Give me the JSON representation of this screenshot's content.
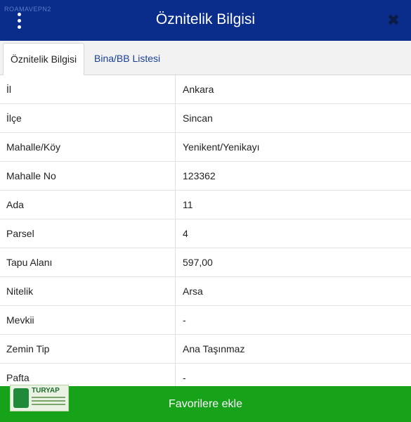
{
  "header": {
    "title": "Öznitelik Bilgisi",
    "corner_text": "ROAMAVEPN2",
    "menu_icon": "vertical-dots-icon",
    "close_icon": "close-icon",
    "close_glyph": "✖"
  },
  "tabs": [
    {
      "label": "Öznitelik Bilgisi",
      "active": true
    },
    {
      "label": "Bina/BB Listesi",
      "active": false
    }
  ],
  "rows": [
    {
      "label": "İl",
      "value": "Ankara"
    },
    {
      "label": "İlçe",
      "value": "Sincan"
    },
    {
      "label": "Mahalle/Köy",
      "value": "Yenikent/Yenikayı"
    },
    {
      "label": "Mahalle No",
      "value": "123362"
    },
    {
      "label": "Ada",
      "value": "11"
    },
    {
      "label": "Parsel",
      "value": "4"
    },
    {
      "label": "Tapu Alanı",
      "value": "597,00"
    },
    {
      "label": "Nitelik",
      "value": "Arsa"
    },
    {
      "label": "Mevkii",
      "value": "-"
    },
    {
      "label": "Zemin Tip",
      "value": "Ana Taşınmaz"
    },
    {
      "label": "Pafta",
      "value": "-"
    }
  ],
  "footer": {
    "label": "Favorilere ekle"
  },
  "logo": {
    "brand": "TURYAP"
  },
  "colors": {
    "header": "#0a2d8c",
    "footer": "#16a31a",
    "link": "#1a3f99"
  }
}
